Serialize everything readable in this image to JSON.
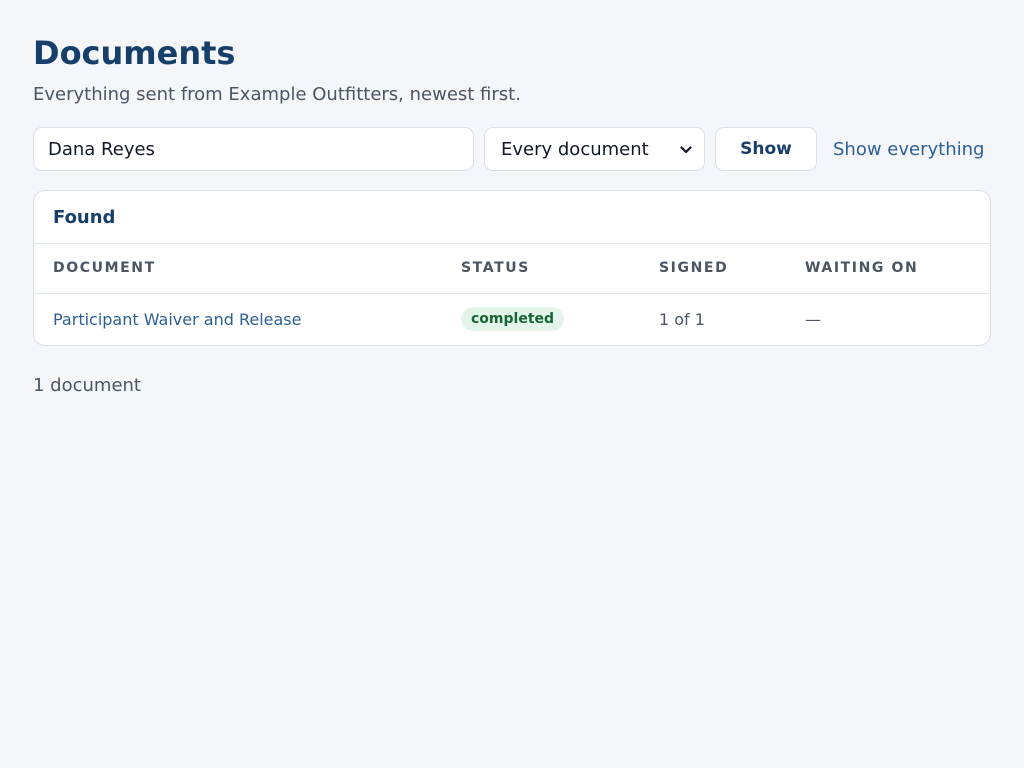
{
  "header": {
    "title": "Documents",
    "subtitle": "Everything sent from Example Outfitters, newest first."
  },
  "filters": {
    "search_value": "Dana Reyes",
    "type_select_value": "Every document",
    "show_label": "Show",
    "show_all_label": "Show everything"
  },
  "results": {
    "heading": "Found",
    "columns": [
      "DOCUMENT",
      "STATUS",
      "SIGNED",
      "WAITING ON"
    ],
    "rows": [
      {
        "document": "Participant Waiver and Release",
        "status": "completed",
        "signed": "1 of 1",
        "waiting_on": "—"
      }
    ],
    "count_text": "1 document"
  },
  "colors": {
    "title": "#173f6b",
    "link": "#2b5f96",
    "status_completed_bg": "#e3f5ea",
    "status_completed_text": "#166534"
  },
  "icons": {
    "select_chevron": "chevron-down-icon"
  }
}
